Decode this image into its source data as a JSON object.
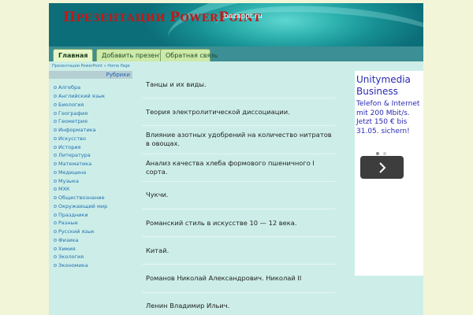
{
  "header": {
    "title_parts": [
      {
        "big": "П",
        "small": "РЕЗЕНТАЦИИ "
      },
      {
        "big": "P",
        "small": "OWER"
      },
      {
        "big": "P",
        "small": "OINT"
      }
    ],
    "url": "bazappt.ru"
  },
  "nav": {
    "tabs": [
      {
        "label": "Главная",
        "active": true
      },
      {
        "label": "Добавить презентацию",
        "active": false
      },
      {
        "label": "Обратная связь",
        "active": false
      }
    ]
  },
  "breadcrumb": {
    "items": [
      "Презентации PowerPoint",
      "»",
      "Home Page"
    ]
  },
  "sidebar": {
    "heading": "Рубрики",
    "items": [
      "Алгебра",
      "Английский язык",
      "Биология",
      "География",
      "Геометрия",
      "Информатика",
      "Искусство",
      "История",
      "Литература",
      "Математика",
      "Медицина",
      "Музыка",
      "МХК",
      "Обществознание",
      "Окружающий мир",
      "Праздники",
      "Разные",
      "Русский язык",
      "Физика",
      "Химия",
      "Экология",
      "Экономика"
    ]
  },
  "posts": [
    "Танцы и их виды.",
    "Теория электролитической диссоциации.",
    "Влияние азотных удобрений на количество нитратов в овощах.",
    "Анализ качества хлеба формового пшеничного I сорта.",
    "Чукчи.",
    "Романский стиль в искусстве 10 — 12 века.",
    "Китай.",
    "Романов Николай Александрович. Николай II",
    "Ленин Владимир Ильич."
  ],
  "ad": {
    "brand_line1": "Unitymedia",
    "brand_line2": "Business",
    "text": "Telefon & Internet mit 200 Mbit/s. Jetzt 150 € bis 31.05. sichern!"
  },
  "colors": {
    "title": "#c21818",
    "link": "#1f6fb0",
    "ad_text": "#2a2ab5",
    "page_bg": "#cdeee8"
  },
  "icons": {
    "sidebar_bullet": "circle-bullet-icon",
    "ad_next": "chevron-right-icon"
  }
}
